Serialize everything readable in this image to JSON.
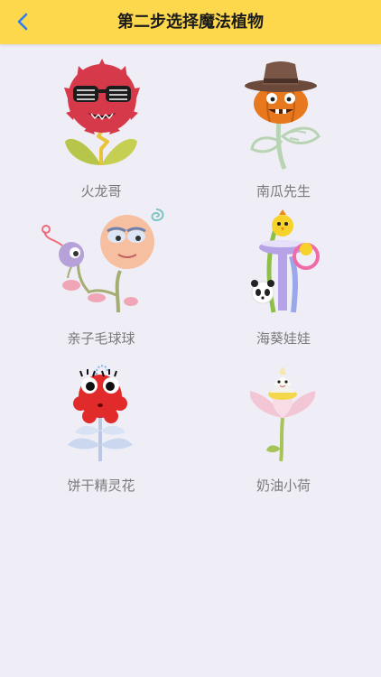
{
  "header": {
    "title": "第二步选择魔法植物",
    "back_icon": "chevron-left-icon",
    "background": "#fed84c",
    "back_color": "#2b7cf6"
  },
  "plants": [
    {
      "name": "火龙哥"
    },
    {
      "name": "南瓜先生"
    },
    {
      "name": "亲子毛球球"
    },
    {
      "name": "海葵娃娃"
    },
    {
      "name": "饼干精灵花"
    },
    {
      "name": "奶油小荷"
    }
  ]
}
